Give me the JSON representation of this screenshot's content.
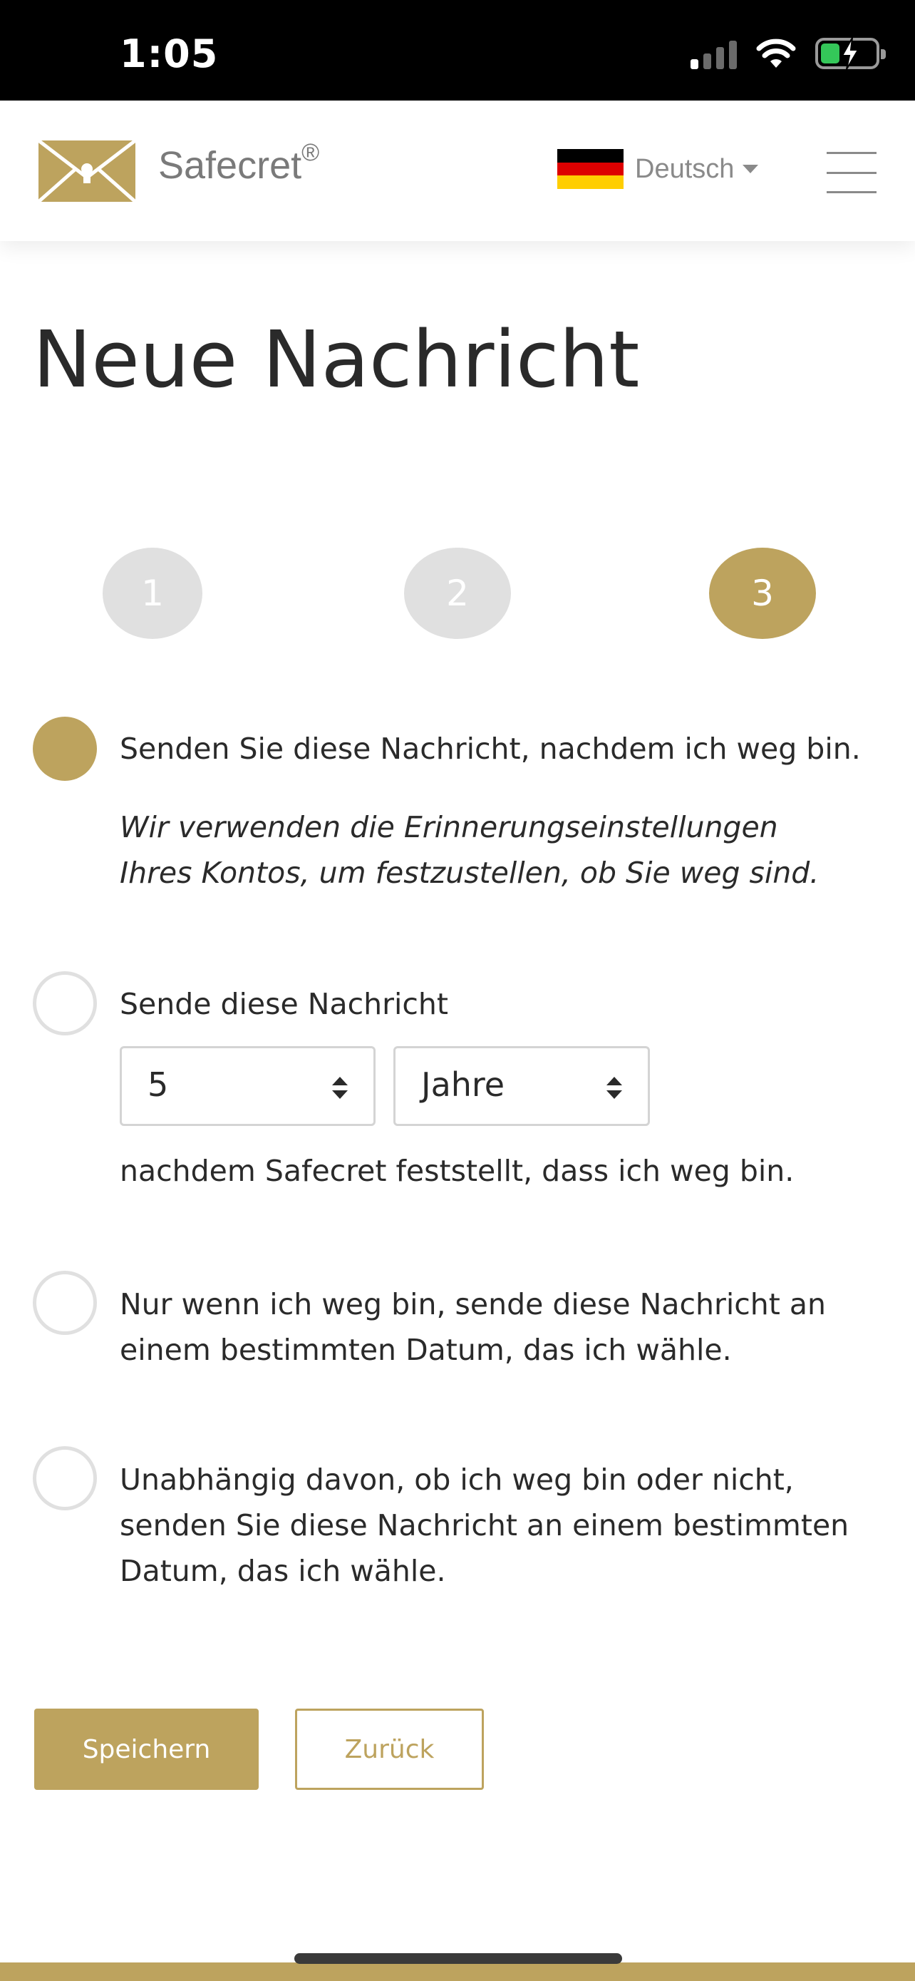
{
  "status_bar": {
    "time": "1:05"
  },
  "header": {
    "brand": "Safecret",
    "brand_mark": "®",
    "language": "Deutsch",
    "icons": [
      "envelope-logo-icon",
      "germany-flag-icon",
      "caret-down-icon",
      "hamburger-menu-icon"
    ]
  },
  "page": {
    "title": "Neue Nachricht"
  },
  "steps": [
    {
      "label": "1",
      "state": "inactive"
    },
    {
      "label": "2",
      "state": "inactive"
    },
    {
      "label": "3",
      "state": "active"
    }
  ],
  "options": {
    "after_gone": {
      "label": "Senden Sie diese Nachricht, nachdem ich weg bin.",
      "note_line1": "Wir verwenden die Erinnerungseinstellungen",
      "note_line2": "Ihres Kontos, um festzustellen, ob Sie weg sind.",
      "checked": true
    },
    "delay": {
      "label": "Sende diese Nachricht",
      "amount": "5",
      "unit": "Jahre",
      "suffix": "nachdem Safecret feststellt, dass ich weg bin.",
      "checked": false
    },
    "date_if_gone": {
      "line1": "Nur wenn ich weg bin, sende diese Nachricht an",
      "line2": "einem bestimmten Datum, das ich wähle.",
      "checked": false
    },
    "date_always": {
      "line1": "Unabhängig davon, ob ich weg bin oder nicht,",
      "line2": "senden Sie diese Nachricht an einem bestimmten",
      "line3": "Datum, das ich wähle.",
      "checked": false
    }
  },
  "buttons": {
    "save": "Speichern",
    "back": "Zurück"
  },
  "colors": {
    "accent": "#bda35e",
    "inactive": "#e0e0e0",
    "text": "#2a2a2a"
  }
}
